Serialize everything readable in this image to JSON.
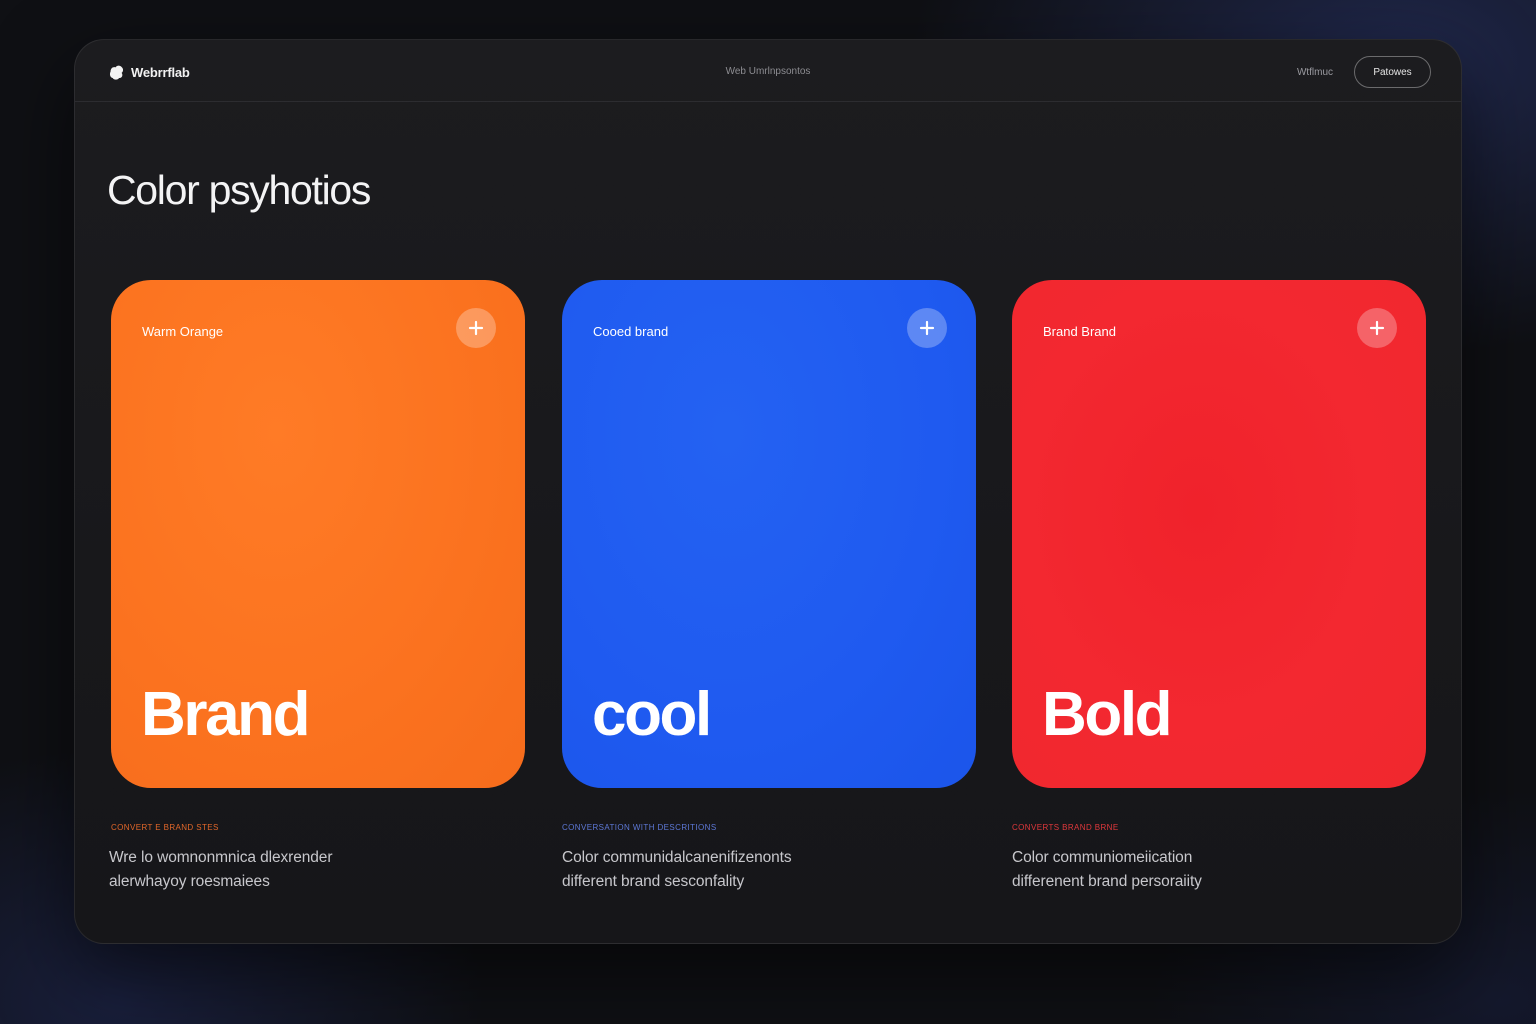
{
  "header": {
    "brand": "Webrrflab",
    "nav_center": "Web Umrlnpsontos",
    "nav_link": "Wtflmuc",
    "nav_button": "Patowes"
  },
  "main": {
    "title": "Color psyhotios",
    "cards": [
      {
        "label": "Warm Orange",
        "word": "Brand",
        "color": "#fb721f",
        "caption": "CONVERT E BRAND STES",
        "description": [
          "Wre lo womnonmnica dlexrender",
          "alerwhayoy roesmaiees"
        ]
      },
      {
        "label": "Cooed brand",
        "word": "cool",
        "color": "#1f5af0",
        "caption": "CONVERSATION WITH DESCRITIONS",
        "description": [
          "Color communidalcanenifizenonts",
          "different brand sesconfality"
        ]
      },
      {
        "label": "Brand Brand",
        "word": "Bold",
        "color": "#f32830",
        "caption": "CONVERTS BRAND BRNE",
        "description": [
          "Color communiomeiication",
          "differenent brand persoraiity"
        ]
      }
    ]
  }
}
